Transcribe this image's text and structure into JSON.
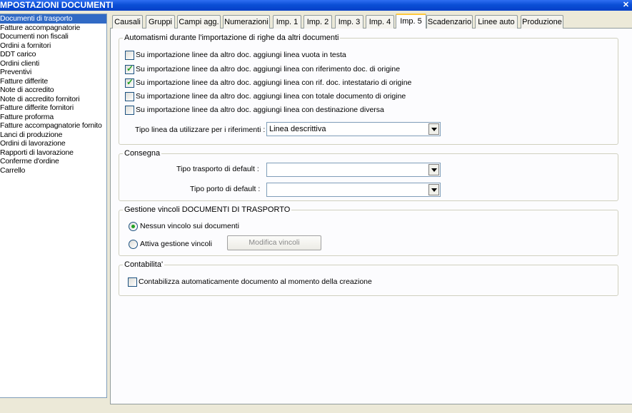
{
  "window": {
    "title": "MPOSTAZIONI DOCUMENTI",
    "close_glyph": "✕"
  },
  "sidebar": {
    "items": [
      {
        "label": "Documenti di trasporto",
        "selected": true
      },
      {
        "label": "Fatture accompagnatorie"
      },
      {
        "label": "Documenti non fiscali"
      },
      {
        "label": "Ordini a fornitori"
      },
      {
        "label": "DDT carico"
      },
      {
        "label": "Ordini clienti"
      },
      {
        "label": "Preventivi"
      },
      {
        "label": "Fatture differite"
      },
      {
        "label": "Note di accredito"
      },
      {
        "label": "Note di accredito fornitori"
      },
      {
        "label": "Fatture differite fornitori"
      },
      {
        "label": "Fatture proforma"
      },
      {
        "label": "Fatture accompagnatorie fornito"
      },
      {
        "label": "Lanci di produzione"
      },
      {
        "label": "Ordini di lavorazione"
      },
      {
        "label": "Rapporti di lavorazione"
      },
      {
        "label": "Conferme d'ordine"
      },
      {
        "label": "Carrello"
      }
    ]
  },
  "tabs": [
    {
      "label": "Causali"
    },
    {
      "label": "Gruppi"
    },
    {
      "label": "Campi agg."
    },
    {
      "label": "Numerazioni"
    },
    {
      "label": "Imp. 1"
    },
    {
      "label": "Imp. 2"
    },
    {
      "label": "Imp. 3"
    },
    {
      "label": "Imp. 4"
    },
    {
      "label": "Imp. 5",
      "active": true
    },
    {
      "label": "Scadenzario"
    },
    {
      "label": "Linee auto"
    },
    {
      "label": "Produzione"
    }
  ],
  "automatismi": {
    "legend": "Automatismi durante l'importazione di righe da altri documenti",
    "checks": [
      {
        "label": "Su importazione linee da altro doc. aggiungi linea vuota in testa",
        "checked": false
      },
      {
        "label": "Su importazione linee da altro doc. aggiungi linea con riferimento doc. di origine",
        "checked": true
      },
      {
        "label": "Su importazione linee da altro doc. aggiungi linea con rif. doc. intestatario di origine",
        "checked": true
      },
      {
        "label": "Su importazione linee da altro doc. aggiungi linea con totale documento di origine",
        "checked": false
      },
      {
        "label": "Su importazione linee da altro doc. aggiungi linea con destinazione diversa",
        "checked": false
      }
    ],
    "tipo_linea_label": "Tipo linea da utilizzare per i riferimenti :",
    "tipo_linea_value": "Linea descrittiva"
  },
  "consegna": {
    "legend": "Consegna",
    "trasporto_label": "Tipo trasporto di default :",
    "trasporto_value": "",
    "porto_label": "Tipo porto di default :",
    "porto_value": ""
  },
  "vincoli": {
    "legend": "Gestione vincoli DOCUMENTI DI TRASPORTO",
    "options": [
      {
        "label": "Nessun vincolo sui documenti",
        "selected": true
      },
      {
        "label": "Attiva gestione vincoli",
        "selected": false
      }
    ],
    "modifica_button": "Modifica vincoli"
  },
  "contabilita": {
    "legend": "Contabilita'",
    "check_label": "Contabilizza automaticamente documento al momento della creazione",
    "checked": false
  },
  "colors": {
    "accent": "#316ac5",
    "titlebar": "#0b4fd6",
    "check": "#21a121",
    "tab_highlight": "#ffc83c"
  },
  "icons": {
    "check": "checkmark-icon",
    "dropdown": "chevron-down-icon",
    "close": "close-icon"
  }
}
